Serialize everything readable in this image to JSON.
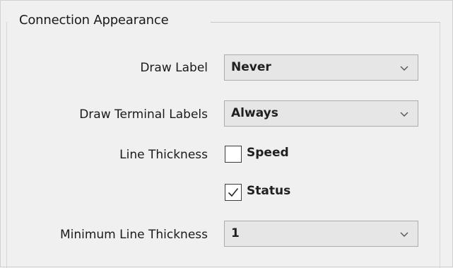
{
  "group": {
    "title": "Connection Appearance"
  },
  "draw_label": {
    "label": "Draw Label",
    "value": "Never"
  },
  "draw_terminal_labels": {
    "label": "Draw Terminal Labels",
    "value": "Always"
  },
  "line_thickness": {
    "label": "Line Thickness",
    "options": [
      {
        "label": "Speed",
        "checked": false
      },
      {
        "label": "Status",
        "checked": true
      }
    ]
  },
  "minimum_line_thickness": {
    "label": "Minimum Line Thickness",
    "value": "1"
  },
  "icons": {
    "dropdown": "chevron-down-icon",
    "check": "checkmark-icon"
  }
}
